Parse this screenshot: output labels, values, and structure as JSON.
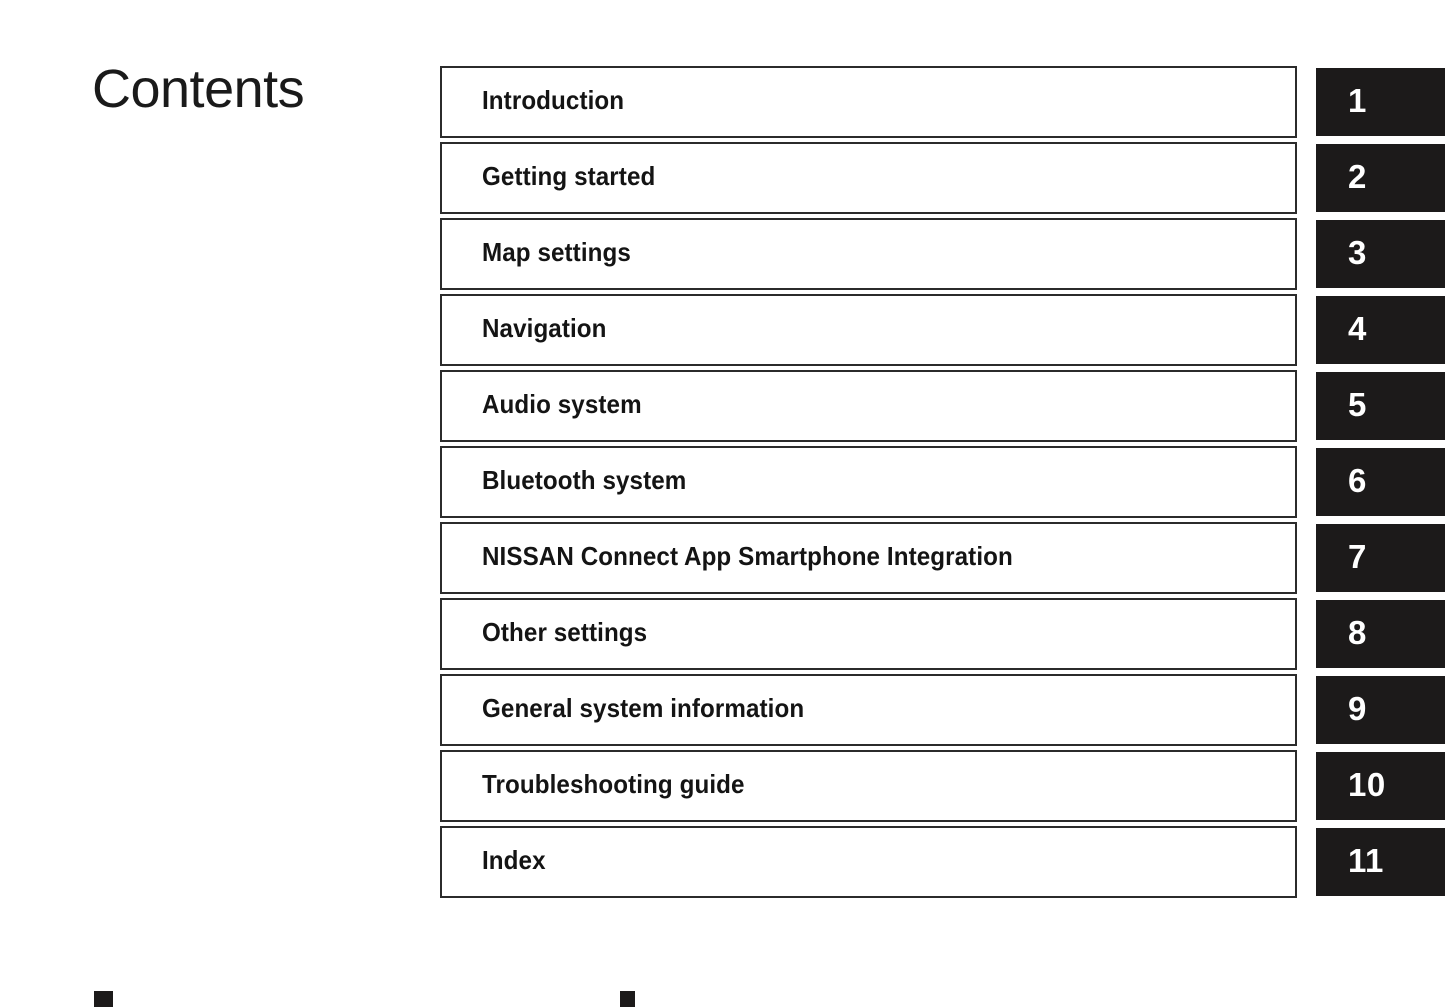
{
  "page": {
    "title": "Contents",
    "background_color": "#ffffff",
    "border_color": "#2b2b2b",
    "tab_background_color": "#1c1a1a",
    "tab_text_color": "#ffffff",
    "text_color": "#141414"
  },
  "contents": {
    "items": [
      {
        "label": "Introduction",
        "tab": "1"
      },
      {
        "label": "Getting started",
        "tab": "2"
      },
      {
        "label": "Map settings",
        "tab": "3"
      },
      {
        "label": "Navigation",
        "tab": "4"
      },
      {
        "label": "Audio system",
        "tab": "5"
      },
      {
        "label": "Bluetooth system",
        "tab": "6"
      },
      {
        "label": "NISSAN Connect App Smartphone Integration",
        "tab": "7"
      },
      {
        "label": "Other settings",
        "tab": "8"
      },
      {
        "label": "General system information",
        "tab": "9"
      },
      {
        "label": "Troubleshooting guide",
        "tab": "10"
      },
      {
        "label": "Index",
        "tab": "11"
      }
    ]
  },
  "footer": {
    "marks": [
      "",
      ""
    ]
  }
}
